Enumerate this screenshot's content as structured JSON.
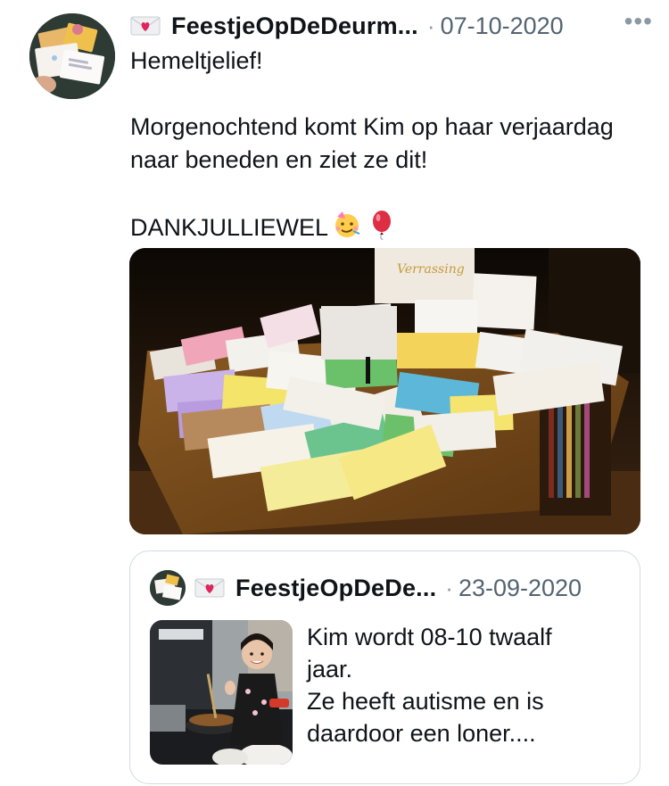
{
  "tweet": {
    "display_name": "FeestjeOpDeDeurm...",
    "name_icon": "love-letter-icon",
    "separator": "·",
    "date": "07-10-2020",
    "more_label": "•••",
    "paragraphs": [
      "Hemeltjelief!",
      "",
      "Morgenochtend komt Kim op haar verjaardag naar beneden en ziet ze dit!",
      "",
      "DANKJULLIEWEL"
    ],
    "emojis": [
      "partying-face-icon",
      "balloon-icon"
    ],
    "photo_banner_text": "Verrassing"
  },
  "quoted": {
    "display_name": "FeestjeOpDeDe...",
    "name_icon": "love-letter-icon",
    "separator": "·",
    "date": "23-09-2020",
    "text_lines": [
      "Kim wordt 08-10 twaalf",
      "jaar.",
      "Ze heeft autisme en is",
      "daardoor een loner...."
    ]
  },
  "colors": {
    "text": "#0f1419",
    "muted": "#536471",
    "border": "#d4dbe1",
    "heart": "#e0245e"
  }
}
